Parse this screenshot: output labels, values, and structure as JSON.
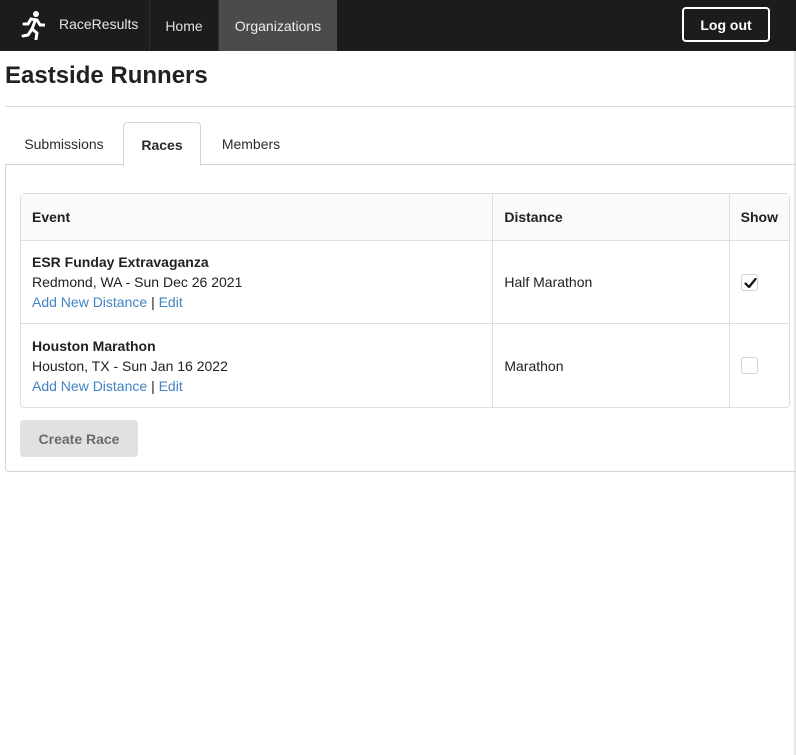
{
  "navbar": {
    "brand_label": "RaceResults",
    "brand_icon": "runner-icon",
    "home_label": "Home",
    "organizations_label": "Organizations",
    "logout_label": "Log out"
  },
  "page": {
    "title": "Eastside Runners"
  },
  "tabs": [
    {
      "label": "Submissions",
      "active": false
    },
    {
      "label": "Races",
      "active": true
    },
    {
      "label": "Members",
      "active": false
    }
  ],
  "table": {
    "headers": {
      "event": "Event",
      "distance": "Distance",
      "show": "Show"
    },
    "rows": [
      {
        "name": "ESR Funday Extravaganza",
        "location_date": "Redmond, WA - Sun Dec 26 2021",
        "add_distance_label": "Add New Distance",
        "separator": "|",
        "edit_label": "Edit",
        "distance": "Half Marathon",
        "show": true
      },
      {
        "name": "Houston Marathon",
        "location_date": "Houston, TX - Sun Jan 16 2022",
        "add_distance_label": "Add New Distance",
        "separator": "|",
        "edit_label": "Edit",
        "distance": "Marathon",
        "show": false
      }
    ]
  },
  "create_race_label": "Create Race",
  "colors": {
    "navbar_bg": "#1b1c1d",
    "active_nav_bg": "#4a4b4c",
    "link": "#4183c4",
    "button_bg": "#e0e1e2"
  }
}
